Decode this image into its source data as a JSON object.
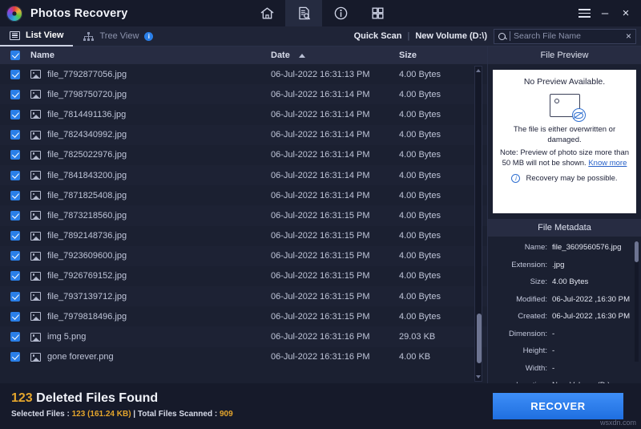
{
  "window": {
    "app_title": "Photos Recovery",
    "logo_icon": "aperture-logo-icon",
    "nav_icons": [
      {
        "name": "home-icon",
        "active": false
      },
      {
        "name": "document-search-icon",
        "active": true
      },
      {
        "name": "info-icon",
        "active": false
      },
      {
        "name": "grid-icon",
        "active": false
      }
    ],
    "menu_icon": "hamburger-menu-icon",
    "minimize_label": "–",
    "close_label": "×"
  },
  "toolbar": {
    "list_view_label": "List View",
    "tree_view_label": "Tree View",
    "tree_view_badge": "i",
    "scan_mode": "Quick Scan",
    "separator": "|",
    "volume": "New Volume (D:\\)",
    "search_placeholder": "Search File Name",
    "search_value": "",
    "search_clear_label": "×"
  },
  "file_list": {
    "columns": {
      "name": "Name",
      "date": "Date",
      "size": "Size"
    },
    "sort_column": "Date",
    "sort_direction": "asc",
    "select_all_checked": true,
    "rows": [
      {
        "name": "file_7792877056.jpg",
        "date": "06-Jul-2022 16:31:13 PM",
        "size": "4.00 Bytes",
        "checked": true
      },
      {
        "name": "file_7798750720.jpg",
        "date": "06-Jul-2022 16:31:14 PM",
        "size": "4.00 Bytes",
        "checked": true
      },
      {
        "name": "file_7814491136.jpg",
        "date": "06-Jul-2022 16:31:14 PM",
        "size": "4.00 Bytes",
        "checked": true
      },
      {
        "name": "file_7824340992.jpg",
        "date": "06-Jul-2022 16:31:14 PM",
        "size": "4.00 Bytes",
        "checked": true
      },
      {
        "name": "file_7825022976.jpg",
        "date": "06-Jul-2022 16:31:14 PM",
        "size": "4.00 Bytes",
        "checked": true
      },
      {
        "name": "file_7841843200.jpg",
        "date": "06-Jul-2022 16:31:14 PM",
        "size": "4.00 Bytes",
        "checked": true
      },
      {
        "name": "file_7871825408.jpg",
        "date": "06-Jul-2022 16:31:14 PM",
        "size": "4.00 Bytes",
        "checked": true
      },
      {
        "name": "file_7873218560.jpg",
        "date": "06-Jul-2022 16:31:15 PM",
        "size": "4.00 Bytes",
        "checked": true
      },
      {
        "name": "file_7892148736.jpg",
        "date": "06-Jul-2022 16:31:15 PM",
        "size": "4.00 Bytes",
        "checked": true
      },
      {
        "name": "file_7923609600.jpg",
        "date": "06-Jul-2022 16:31:15 PM",
        "size": "4.00 Bytes",
        "checked": true
      },
      {
        "name": "file_7926769152.jpg",
        "date": "06-Jul-2022 16:31:15 PM",
        "size": "4.00 Bytes",
        "checked": true
      },
      {
        "name": "file_7937139712.jpg",
        "date": "06-Jul-2022 16:31:15 PM",
        "size": "4.00 Bytes",
        "checked": true
      },
      {
        "name": "file_7979818496.jpg",
        "date": "06-Jul-2022 16:31:15 PM",
        "size": "4.00 Bytes",
        "checked": true
      },
      {
        "name": "img 5.png",
        "date": "06-Jul-2022 16:31:16 PM",
        "size": "29.03 KB",
        "checked": true
      },
      {
        "name": "gone forever.png",
        "date": "06-Jul-2022 16:31:16 PM",
        "size": "4.00 KB",
        "checked": true
      }
    ]
  },
  "preview": {
    "header": "File Preview",
    "title": "No Preview Available.",
    "line1": "The file is either overwritten or",
    "line2": "damaged.",
    "note1": "Note: Preview of photo size more than",
    "note2": "50 MB will not be shown.",
    "know_more": "Know more",
    "recovery_text": "Recovery may be possible.",
    "image_icon": "image-placeholder-icon",
    "eye_icon": "eye-off-icon",
    "info_icon": "info-circle-icon"
  },
  "metadata": {
    "header": "File Metadata",
    "fields": [
      {
        "key": "Name:",
        "value": "file_3609560576.jpg"
      },
      {
        "key": "Extension:",
        "value": ".jpg"
      },
      {
        "key": "Size:",
        "value": "4.00 Bytes"
      },
      {
        "key": "Modified:",
        "value": "06-Jul-2022 ,16:30 PM"
      },
      {
        "key": "Created:",
        "value": "06-Jul-2022 ,16:30 PM"
      },
      {
        "key": "Dimension:",
        "value": "-"
      },
      {
        "key": "Height:",
        "value": "-"
      },
      {
        "key": "Width:",
        "value": "-"
      },
      {
        "key": "Location:",
        "value": "New Volume (D:)\n\\DR STRANGE"
      }
    ]
  },
  "status": {
    "found_count": "123",
    "found_label": "Deleted Files Found",
    "selected_prefix": "Selected Files : ",
    "selected_count": "123",
    "selected_size": "(161.24 KB)",
    "scanned_prefix": " | Total Files Scanned : ",
    "scanned_count": "909",
    "recover_label": "RECOVER",
    "watermark": "wsxdn.com"
  },
  "colors": {
    "accent_blue": "#2a7fe8",
    "amber": "#e4a52c",
    "panel_bg": "#1b2031",
    "header_bg": "#272c42",
    "titlebar_bg": "#161a2a"
  }
}
